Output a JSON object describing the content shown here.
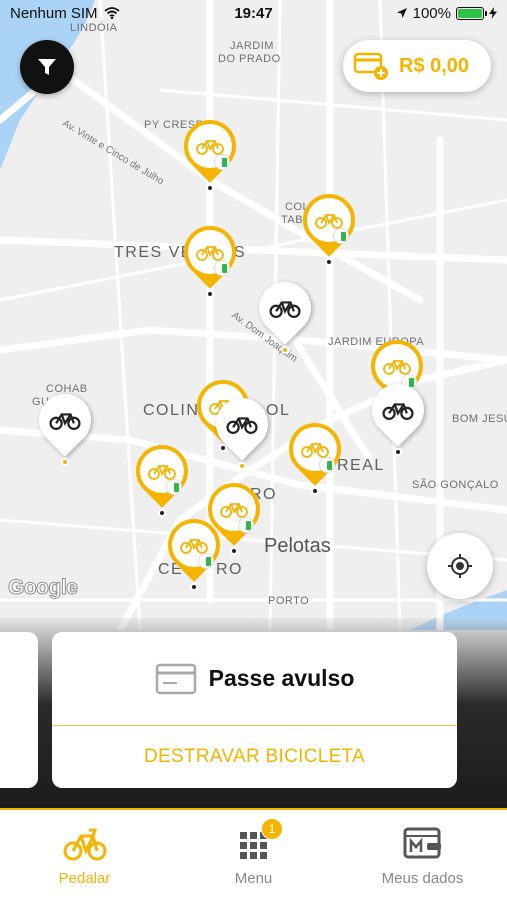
{
  "status_bar": {
    "carrier": "Nenhum SIM",
    "time": "19:47",
    "battery": "100%"
  },
  "map": {
    "labels": {
      "lindoia": "LINDÓIA",
      "jardim_do_prado_1": "JARDIM",
      "jardim_do_prado_2": "DO PRADO",
      "py_cresp": "PY CRESP",
      "av_vinte": "Av. Vinte e Cinco de Julho",
      "col_tab_1": "COL",
      "col_tab_2": "TAB",
      "tres_ve": "TRES VE",
      "s_partial": "S",
      "av_dom": "Av. Dom Joaquim",
      "jardim_europa": "JARDIM EUROPA",
      "cohab_1": "COHAB",
      "cohab_2": "GU",
      "colin": "COLIN",
      "ol": "OL",
      "bom_jesus": "BOM JESU",
      "real": "REAL",
      "sao_goncalo": "SÃO GONÇALO",
      "ce_1": "CE",
      "ro_1": "RO",
      "pelotas": "Pelotas",
      "ce_2": "CE",
      "ro_2": "RO",
      "porto": "PORTO"
    },
    "google_logo": "Google",
    "pin_icon": "bike-icon"
  },
  "wallet": {
    "amount": "R$ 0,00",
    "icon": "card-plus-icon"
  },
  "card": {
    "title": "Passe avulso",
    "action": "DESTRAVAR BICICLETA",
    "icon": "ticket-card-icon"
  },
  "tabs": [
    {
      "label": "Pedalar",
      "icon": "bike-icon",
      "active": true
    },
    {
      "label": "Menu",
      "icon": "grid-icon",
      "badge": "1"
    },
    {
      "label": "Meus dados",
      "icon": "id-card-icon"
    }
  ],
  "colors": {
    "accent": "#f5b400",
    "station_ok": "#2fb84a"
  }
}
